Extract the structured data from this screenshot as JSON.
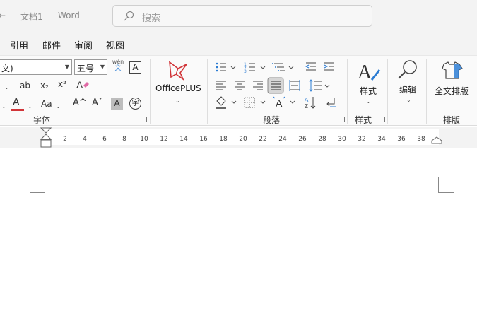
{
  "titlebar": {
    "arrow_fragment": "←",
    "doc_title": "文档1",
    "separator": "-",
    "app_name": "Word"
  },
  "search": {
    "placeholder": "搜索"
  },
  "tabs": [
    "引用",
    "邮件",
    "审阅",
    "视图"
  ],
  "font_group": {
    "font_name": "文)",
    "font_size": "五号",
    "phonetic_top": "wén",
    "phonetic_bottom": "文",
    "clear_format": "A",
    "strike": "ab",
    "subscript": "x₂",
    "superscript": "x²",
    "font_color": "A",
    "change_case": "Aa",
    "grow": "A^",
    "shrink": "Aˇ",
    "shade": "A",
    "enclose": "字",
    "label": "字体"
  },
  "officeplus": {
    "label": "OfficePLUS"
  },
  "paragraph": {
    "label": "段落"
  },
  "styles": {
    "label": "样式",
    "group_label": "样式"
  },
  "editing": {
    "label": "编辑"
  },
  "layout": {
    "label": "全文排版",
    "group_label": "排版"
  },
  "ruler": {
    "ticks": [
      "2",
      "4",
      "6",
      "8",
      "10",
      "12",
      "14",
      "16",
      "18",
      "20",
      "22",
      "24",
      "26",
      "28",
      "30",
      "32",
      "34",
      "36",
      "38"
    ]
  },
  "colors": {
    "accent_red": "#d13438",
    "accent_blue": "#2b7cd3"
  }
}
